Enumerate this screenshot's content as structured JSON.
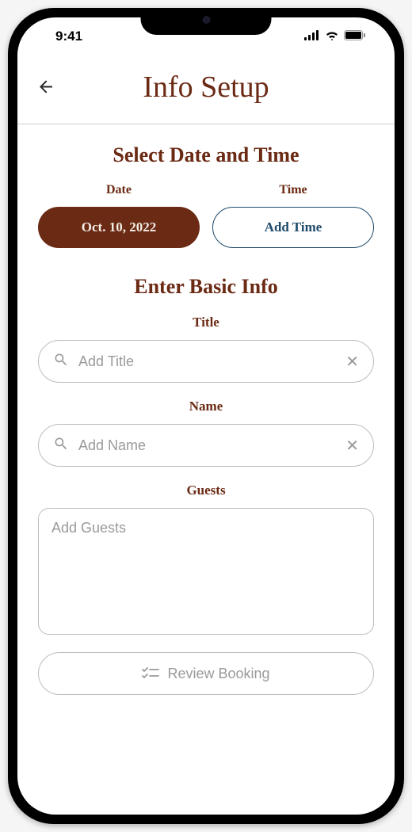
{
  "status": {
    "time": "9:41"
  },
  "header": {
    "title": "Info Setup"
  },
  "section_datetime": {
    "title": "Select Date and Time",
    "date_label": "Date",
    "time_label": "Time",
    "date_value": "Oct. 10, 2022",
    "time_value": "Add Time"
  },
  "section_basic": {
    "title": "Enter Basic Info",
    "title_field": {
      "label": "Title",
      "placeholder": "Add Title"
    },
    "name_field": {
      "label": "Name",
      "placeholder": "Add Name"
    },
    "guests_field": {
      "label": "Guests",
      "placeholder": "Add Guests"
    }
  },
  "review_button": {
    "label": "Review Booking"
  }
}
